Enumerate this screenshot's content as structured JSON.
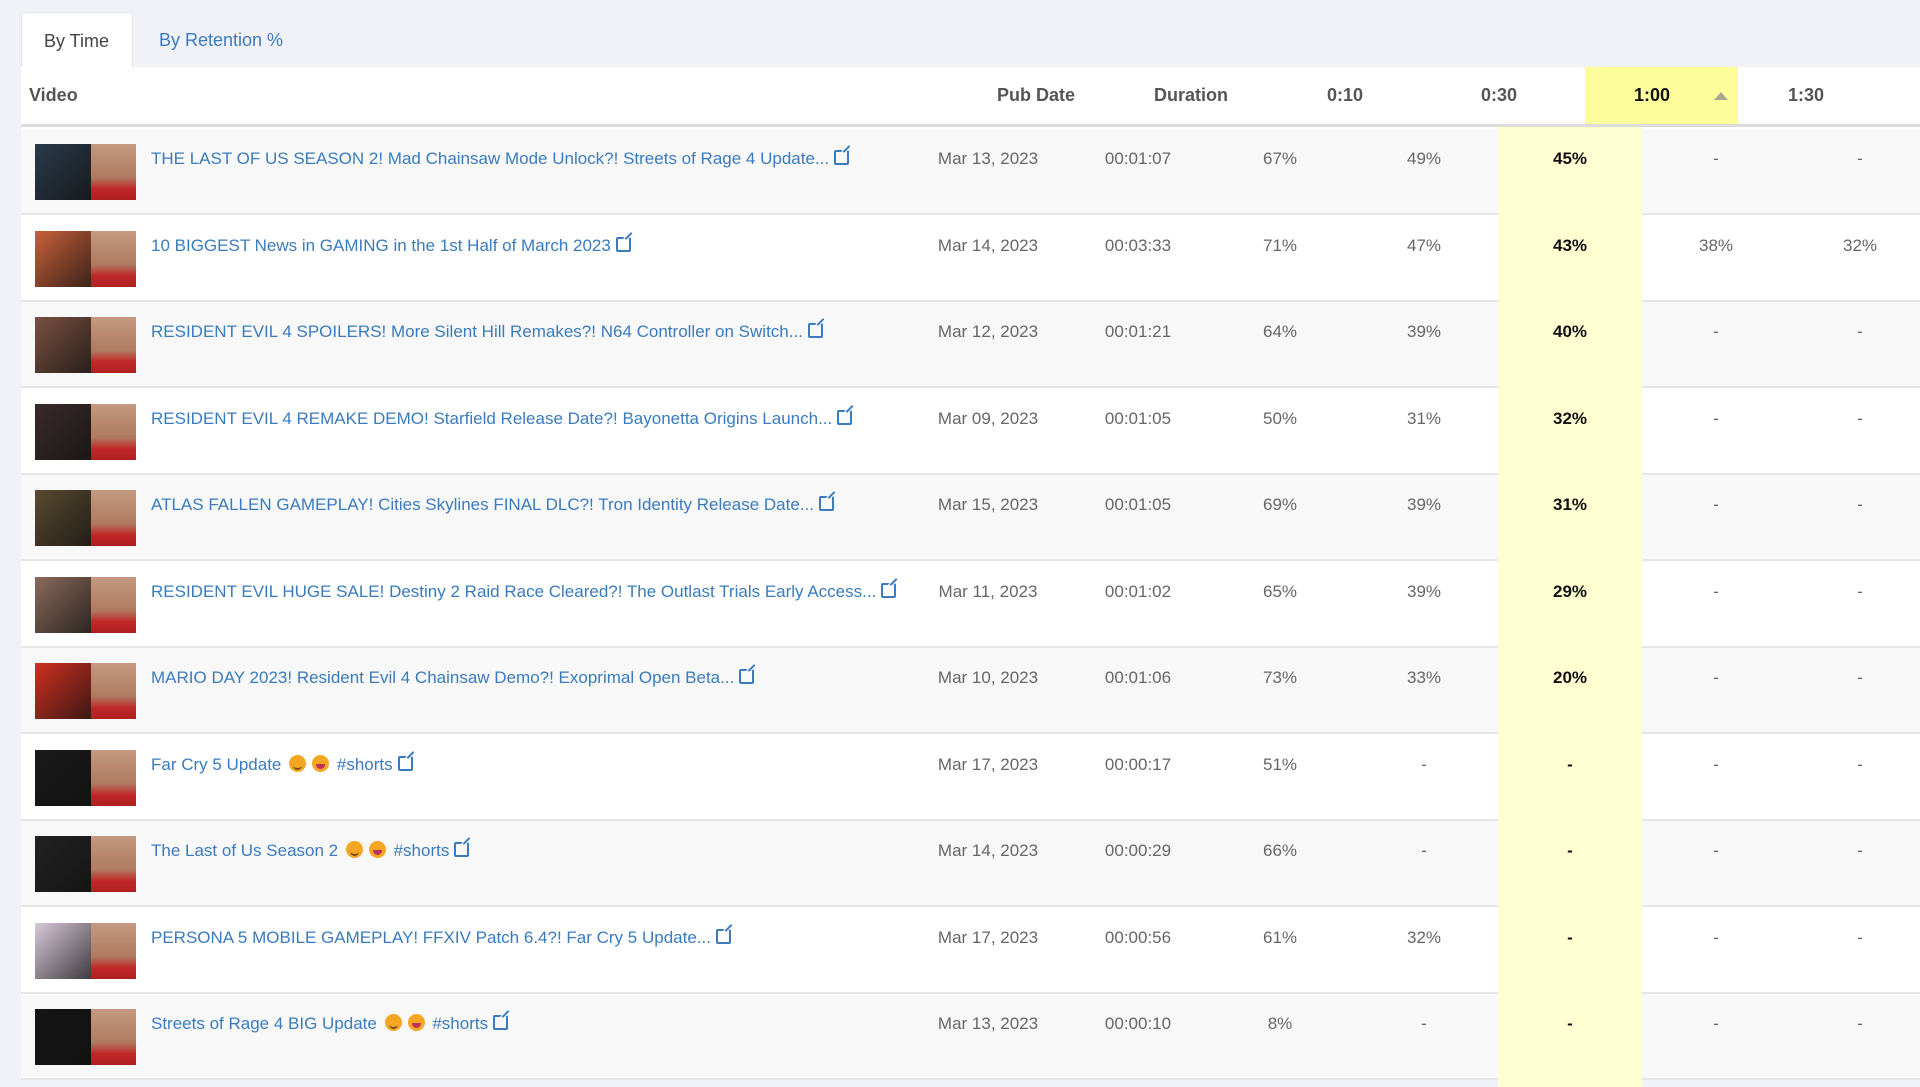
{
  "tabs": [
    {
      "label": "By Time",
      "active": true
    },
    {
      "label": "By Retention %",
      "active": false
    }
  ],
  "colors": {
    "link": "#3a7bbf",
    "highlight_header": "#fdfd9c",
    "highlight_column": "#ffffd2"
  },
  "columns": {
    "video": "Video",
    "pub_date": "Pub Date",
    "duration": "Duration",
    "t010": "0:10",
    "t030": "0:30",
    "t100": "1:00",
    "t130": "1:30"
  },
  "sort": {
    "column": "1:00",
    "direction": "descending",
    "icon": "triangle-up-icon"
  },
  "rows": [
    {
      "title": "THE LAST OF US SEASON 2! Mad Chainsaw Mode Unlock?! Streets of Rage 4 Update...",
      "date": "Mar 13, 2023",
      "duration": "00:01:07",
      "r10": "67%",
      "r30": "49%",
      "r100": "45%",
      "r130": "-",
      "r200": "-",
      "thumb": "#2a3a4a"
    },
    {
      "title": "10 BIGGEST News in GAMING in the 1st Half of March 2023",
      "date": "Mar 14, 2023",
      "duration": "00:03:33",
      "r10": "71%",
      "r30": "47%",
      "r100": "43%",
      "r130": "38%",
      "r200": "32%",
      "thumb": "#c8603a"
    },
    {
      "title": "RESIDENT EVIL 4 SPOILERS! More Silent Hill Remakes?! N64 Controller on Switch...",
      "date": "Mar 12, 2023",
      "duration": "00:01:21",
      "r10": "64%",
      "r30": "39%",
      "r100": "40%",
      "r130": "-",
      "r200": "-",
      "thumb": "#7a5040"
    },
    {
      "title": "RESIDENT EVIL 4 REMAKE DEMO! Starfield Release Date?! Bayonetta Origins Launch...",
      "date": "Mar 09, 2023",
      "duration": "00:01:05",
      "r10": "50%",
      "r30": "31%",
      "r100": "32%",
      "r130": "-",
      "r200": "-",
      "thumb": "#3a2a2a"
    },
    {
      "title": "ATLAS FALLEN GAMEPLAY! Cities Skylines FINAL DLC?! Tron Identity Release Date...",
      "date": "Mar 15, 2023",
      "duration": "00:01:05",
      "r10": "69%",
      "r30": "39%",
      "r100": "31%",
      "r130": "-",
      "r200": "-",
      "thumb": "#5a4a30"
    },
    {
      "title": "RESIDENT EVIL HUGE SALE! Destiny 2 Raid Race Cleared?! The Outlast Trials Early Access...",
      "date": "Mar 11, 2023",
      "duration": "00:01:02",
      "r10": "65%",
      "r30": "39%",
      "r100": "29%",
      "r130": "-",
      "r200": "-",
      "thumb": "#8a6a5a"
    },
    {
      "title": "MARIO DAY 2023! Resident Evil 4 Chainsaw Demo?! Exoprimal Open Beta...",
      "date": "Mar 10, 2023",
      "duration": "00:01:06",
      "r10": "73%",
      "r30": "33%",
      "r100": "20%",
      "r130": "-",
      "r200": "-",
      "thumb": "#d03020"
    },
    {
      "title": "Far Cry 5 Update",
      "suffix": "#shorts",
      "emojis": [
        "smiling-face",
        "grinning-face"
      ],
      "date": "Mar 17, 2023",
      "duration": "00:00:17",
      "r10": "51%",
      "r30": "-",
      "r100": "-",
      "r130": "-",
      "r200": "-",
      "thumb": "#1a1a1a"
    },
    {
      "title": "The Last of Us Season 2",
      "suffix": "#shorts",
      "emojis": [
        "smiling-face",
        "grinning-face"
      ],
      "date": "Mar 14, 2023",
      "duration": "00:00:29",
      "r10": "66%",
      "r30": "-",
      "r100": "-",
      "r130": "-",
      "r200": "-",
      "thumb": "#222"
    },
    {
      "title": "PERSONA 5 MOBILE GAMEPLAY! FFXIV Patch 6.4?! Far Cry 5 Update...",
      "date": "Mar 17, 2023",
      "duration": "00:00:56",
      "r10": "61%",
      "r30": "32%",
      "r100": "-",
      "r130": "-",
      "r200": "-",
      "thumb": "#d8c8d8"
    },
    {
      "title": "Streets of Rage 4 BIG Update",
      "suffix": "#shorts",
      "emojis": [
        "smiling-face",
        "grinning-face"
      ],
      "date": "Mar 13, 2023",
      "duration": "00:00:10",
      "r10": "8%",
      "r30": "-",
      "r100": "-",
      "r130": "-",
      "r200": "-",
      "thumb": "#151515"
    }
  ]
}
